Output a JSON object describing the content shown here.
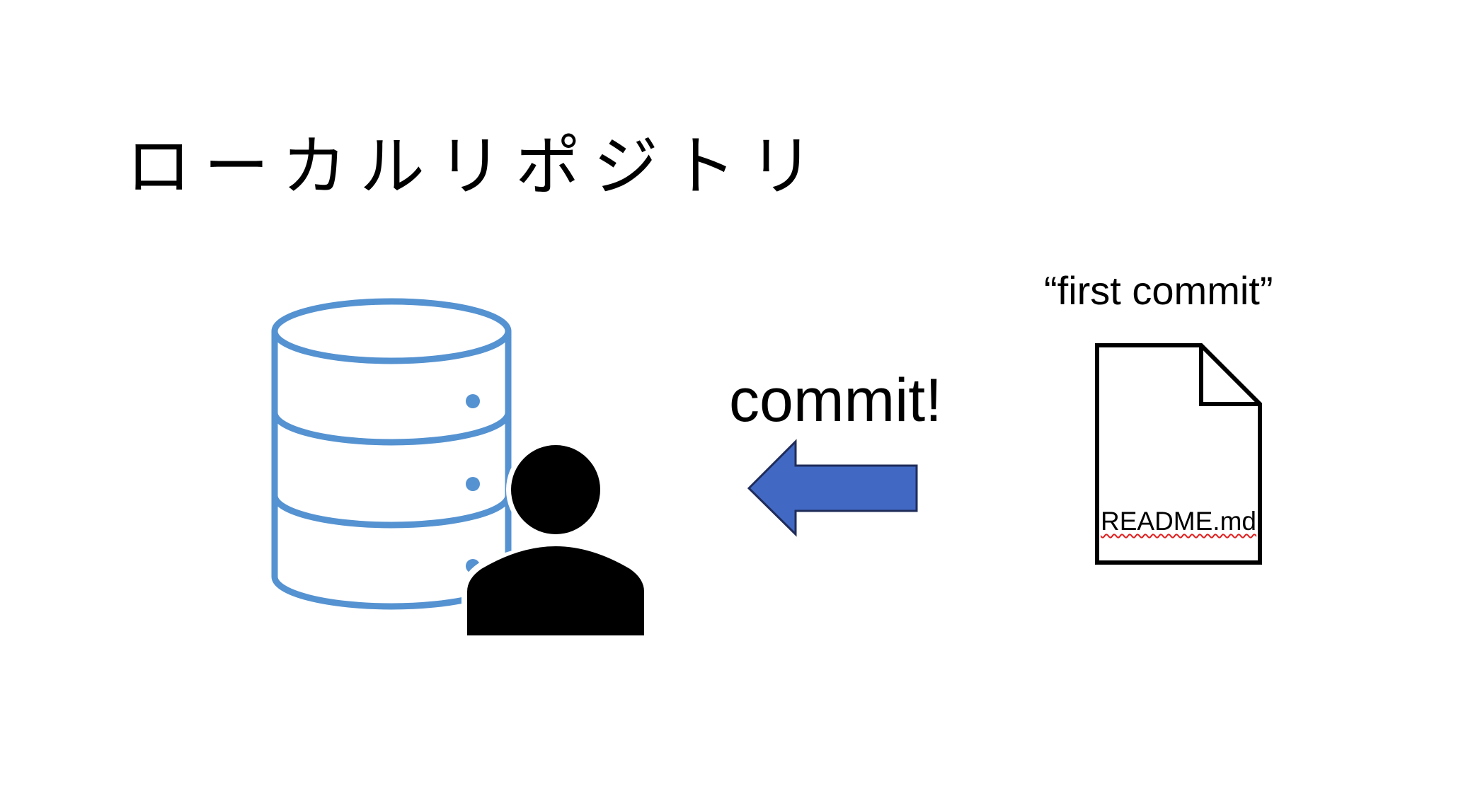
{
  "title": "ローカルリポジトリ",
  "commit_message": "“first commit”",
  "action_label": "commit!",
  "file": {
    "name": "README.md"
  },
  "icons": {
    "repository": "database-icon",
    "user": "person-icon",
    "arrow": "arrow-left-icon",
    "file": "document-icon"
  },
  "colors": {
    "database_stroke": "#5592D1",
    "arrow_fill": "#4169C4",
    "arrow_stroke": "#1F2C5A",
    "person_fill": "#000000",
    "document_stroke": "#000000"
  }
}
